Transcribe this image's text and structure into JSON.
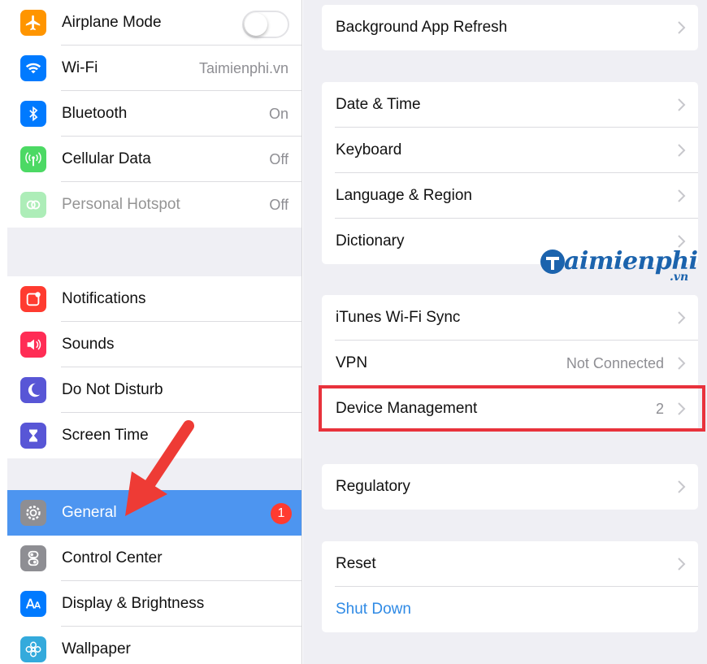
{
  "sidebar": {
    "group1": [
      {
        "label": "Airplane Mode",
        "icon": "airplane-icon",
        "color": "#ff9500",
        "control": "toggle",
        "toggle_on": false
      },
      {
        "label": "Wi-Fi",
        "icon": "wifi-icon",
        "color": "#007aff",
        "value": "Taimienphi.vn"
      },
      {
        "label": "Bluetooth",
        "icon": "bluetooth-icon",
        "color": "#007aff",
        "value": "On"
      },
      {
        "label": "Cellular Data",
        "icon": "cellular-icon",
        "color": "#4cd964",
        "value": "Off"
      },
      {
        "label": "Personal Hotspot",
        "icon": "hotspot-icon",
        "color": "#4cd964",
        "value": "Off"
      }
    ],
    "group2": [
      {
        "label": "Notifications",
        "icon": "notifications-icon",
        "color": "#ff3b30"
      },
      {
        "label": "Sounds",
        "icon": "sounds-icon",
        "color": "#ff2d55"
      },
      {
        "label": "Do Not Disturb",
        "icon": "moon-icon",
        "color": "#5856d6"
      },
      {
        "label": "Screen Time",
        "icon": "hourglass-icon",
        "color": "#5856d6"
      }
    ],
    "group3": [
      {
        "label": "General",
        "icon": "gear-icon",
        "color": "#8e8e93",
        "badge": "1"
      },
      {
        "label": "Control Center",
        "icon": "control-center-icon",
        "color": "#8e8e93"
      },
      {
        "label": "Display & Brightness",
        "icon": "display-icon",
        "color": "#007aff"
      },
      {
        "label": "Wallpaper",
        "icon": "wallpaper-icon",
        "color": "#34aadc"
      }
    ]
  },
  "detail": {
    "group0": [
      {
        "label": "Background App Refresh"
      }
    ],
    "group1": [
      {
        "label": "Date & Time"
      },
      {
        "label": "Keyboard"
      },
      {
        "label": "Language & Region"
      },
      {
        "label": "Dictionary"
      }
    ],
    "group2": [
      {
        "label": "iTunes Wi-Fi Sync"
      },
      {
        "label": "VPN",
        "value": "Not Connected"
      },
      {
        "label": "Device Management",
        "value": "2"
      }
    ],
    "group3": [
      {
        "label": "Regulatory"
      }
    ],
    "group4": [
      {
        "label": "Reset"
      },
      {
        "label": "Shut Down",
        "link": true
      }
    ]
  },
  "watermark": {
    "main": "aimienphi",
    "sub": ".vn"
  },
  "colors": {
    "selected": "#4d95f0",
    "highlight": "#e8323c",
    "arrow": "#ee3b35",
    "link": "#2f8ae5"
  }
}
